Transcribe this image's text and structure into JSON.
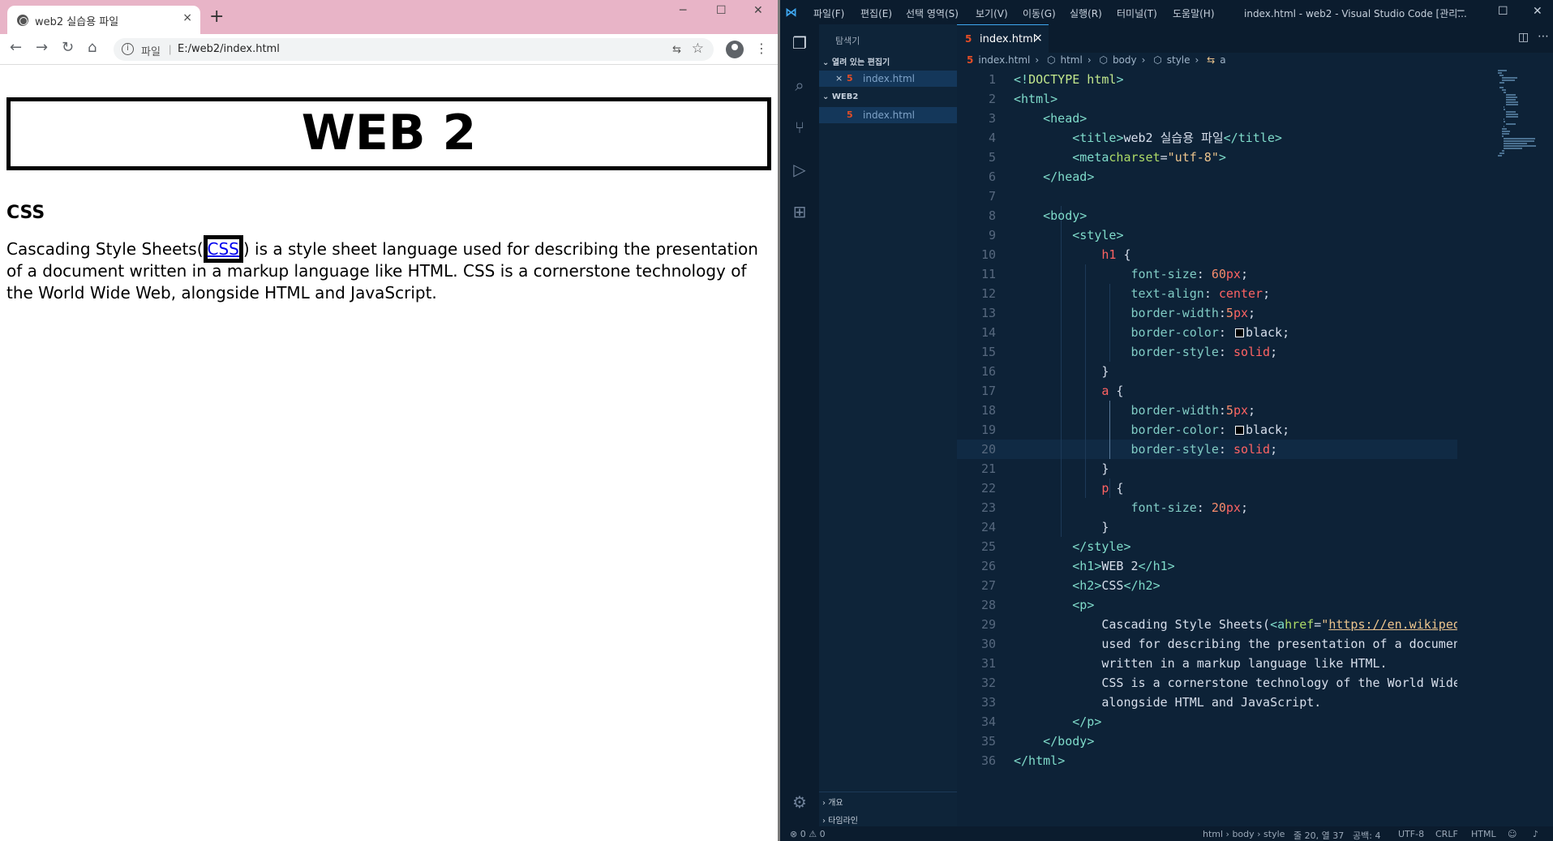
{
  "browser": {
    "tab_title": "web2 실습용 파일",
    "tab_close": "×",
    "new_tab": "+",
    "window_controls": {
      "minimize": "─",
      "maximize": "☐",
      "close": "✕"
    },
    "nav": {
      "back": "←",
      "forward": "→",
      "reload": "↻",
      "home": "⌂"
    },
    "omnibox": {
      "info": "i",
      "scheme_label": "파일",
      "separator": "|",
      "url": "E:/web2/index.html",
      "translate": "⇆",
      "star": "☆"
    },
    "menu": "⋮",
    "page": {
      "h1": "WEB 2",
      "h2": "CSS",
      "p_before": "Cascading Style Sheets(",
      "p_link": "CSS",
      "p_after": ") is a style sheet language used for describing the presentation of a document written in a markup language like HTML. CSS is a cornerstone technology of the World Wide Web, alongside HTML and JavaScript."
    }
  },
  "vscode": {
    "menus": [
      "파일(F)",
      "편집(E)",
      "선택 영역(S)",
      "보기(V)",
      "이동(G)",
      "실행(R)",
      "터미널(T)",
      "도움말(H)"
    ],
    "window_title": "index.html - web2 - Visual Studio Code [관리...",
    "window_controls": {
      "minimize": "─",
      "maximize": "☐",
      "close": "✕"
    },
    "sidebar": {
      "title": "탐색기",
      "open_editors_label": "열려 있는 편집기",
      "open_file_close": "×",
      "open_file": "index.html",
      "folder_label": "WEB2",
      "folder_file": "index.html",
      "outline_label": "개요",
      "timeline_label": "타임라인"
    },
    "tab": {
      "label": "index.html",
      "close": "×"
    },
    "breadcrumb": [
      "index.html",
      "html",
      "body",
      "style",
      "a"
    ],
    "line_numbers": [
      "1",
      "2",
      "3",
      "4",
      "5",
      "6",
      "7",
      "8",
      "9",
      "10",
      "11",
      "12",
      "13",
      "14",
      "15",
      "16",
      "17",
      "18",
      "19",
      "20",
      "21",
      "22",
      "23",
      "24",
      "25",
      "26",
      "27",
      "28",
      "29",
      "30",
      "31",
      "32",
      "33",
      "34",
      "35",
      "36"
    ],
    "statusbar": {
      "problems": "⊗ 0 ⚠ 0",
      "path": "html › body › style",
      "position": "줄 20, 열 37",
      "spaces": "공백: 4",
      "encoding": "UTF-8",
      "eol": "CRLF",
      "language": "HTML"
    },
    "code_lines": [
      "<!DOCTYPE html>",
      "<html>",
      "    <head>",
      "        <title>web2 실습용 파일</title>",
      "        <meta charset=\"utf-8\">",
      "    </head>",
      "",
      "    <body>",
      "        <style>",
      "            h1 {",
      "                font-size: 60px;",
      "                text-align: center;",
      "                border-width:5px;",
      "                border-color: black;",
      "                border-style: solid;",
      "            }",
      "            a {",
      "                border-width:5px;",
      "                border-color: black;",
      "                border-style: solid;",
      "            }",
      "            p {",
      "                font-size: 20px;",
      "            }",
      "        </style>",
      "        <h1>WEB 2</h1>",
      "        <h2>CSS</h2>",
      "        <p>",
      "            Cascading Style Sheets(<a href=\"https://en.wikipedia",
      "            used for describing the presentation of a document",
      "            written in a markup language like HTML.",
      "            CSS is a cornerstone technology of the World Wide Wel",
      "            alongside HTML and JavaScript.",
      "        </p>",
      "    </body>",
      "</html>"
    ]
  }
}
